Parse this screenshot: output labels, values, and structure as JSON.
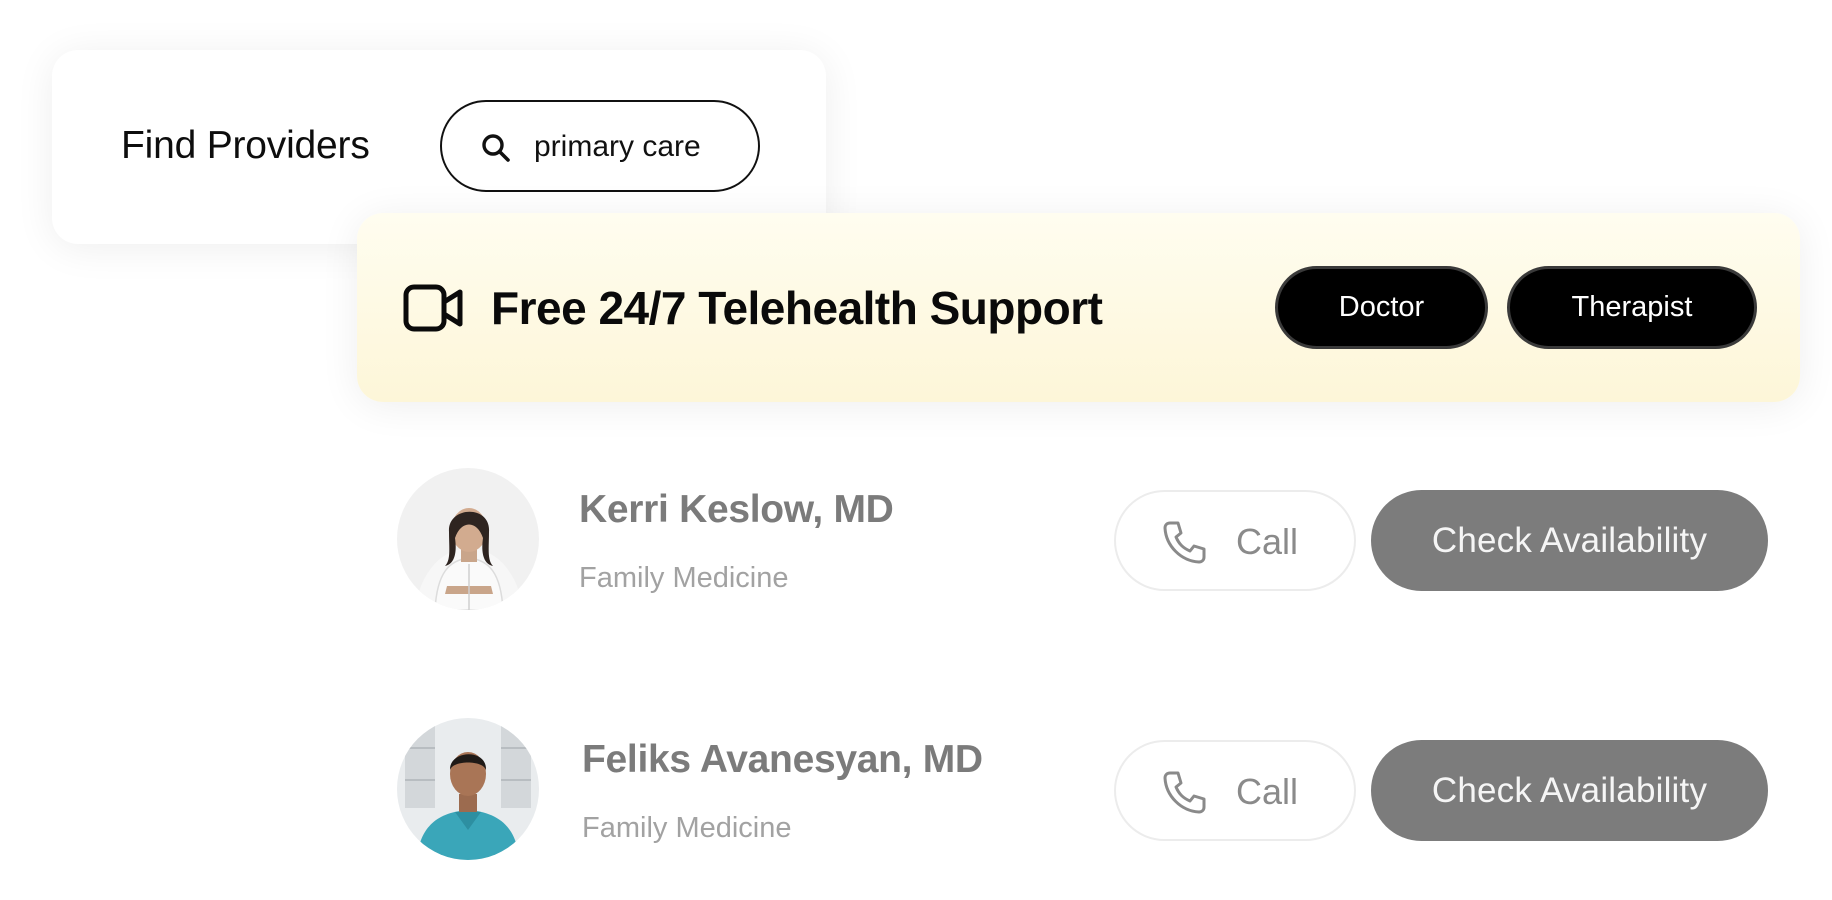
{
  "search_card": {
    "title": "Find Providers",
    "search_value": "primary care",
    "search_icon": "search-icon"
  },
  "banner": {
    "icon": "video-camera-icon",
    "title": "Free 24/7 Telehealth Support",
    "buttons": [
      "Doctor",
      "Therapist"
    ]
  },
  "providers": [
    {
      "name": "Kerri Keslow, MD",
      "specialty": "Family Medicine",
      "call_label": "Call",
      "availability_label": "Check Availability"
    },
    {
      "name": "Feliks Avanesyan, MD",
      "specialty": "Family Medicine",
      "call_label": "Call",
      "availability_label": "Check Availability"
    }
  ],
  "colors": {
    "banner_bg": "#fdf6d8",
    "dark_pill": "#000000",
    "availability_button": "#7c7c7c",
    "muted_text": "#7b7b7b"
  }
}
